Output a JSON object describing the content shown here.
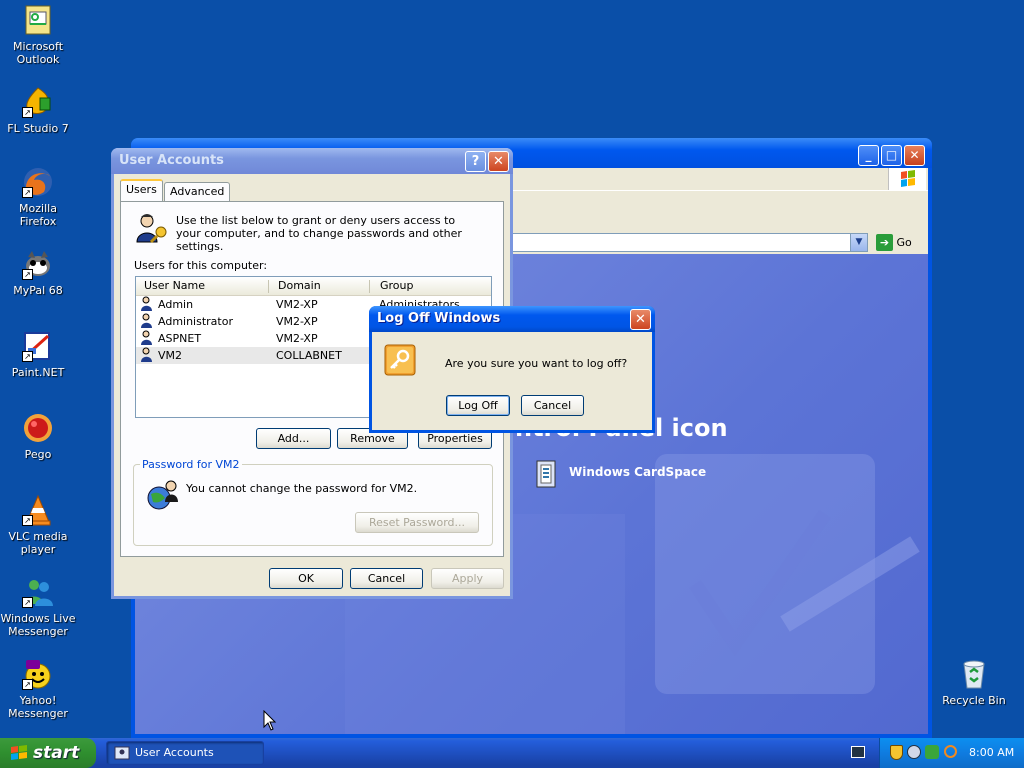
{
  "desktop": {
    "icons": [
      {
        "label": "Microsoft Outlook",
        "icon": "outlook-icon"
      },
      {
        "label": "FL Studio 7",
        "icon": "fl-studio-icon"
      },
      {
        "label": "Mozilla Firefox",
        "icon": "firefox-icon"
      },
      {
        "label": "MyPal 68",
        "icon": "mypal-icon"
      },
      {
        "label": "Paint.NET",
        "icon": "paint-net-icon"
      },
      {
        "label": "Pego",
        "icon": "pego-icon"
      },
      {
        "label": "VLC media player",
        "icon": "vlc-icon"
      },
      {
        "label": "Windows Live Messenger",
        "icon": "messenger-icon"
      },
      {
        "label": "Yahoo! Messenger",
        "icon": "yahoo-messenger-icon"
      },
      {
        "label": "Recycle Bin",
        "icon": "recycle-bin-icon"
      }
    ]
  },
  "explorer": {
    "go_label": "Go",
    "heading_partial": "ntrol Panel icon",
    "cardspace_label": "Windows CardSpace"
  },
  "user_accounts": {
    "title": "User Accounts",
    "help_glyph": "?",
    "close_glyph": "✕",
    "tabs": [
      {
        "label": "Users"
      },
      {
        "label": "Advanced"
      }
    ],
    "intro": "Use the list below to grant or deny users access to your computer, and to change passwords and other settings.",
    "users_label": "Users for this computer:",
    "columns": [
      "User Name",
      "Domain",
      "Group"
    ],
    "rows": [
      {
        "name": "Admin",
        "domain": "VM2-XP",
        "group": "Administrators"
      },
      {
        "name": "Administrator",
        "domain": "VM2-XP",
        "group": ""
      },
      {
        "name": "ASPNET",
        "domain": "VM2-XP",
        "group": ""
      },
      {
        "name": "VM2",
        "domain": "COLLABNET",
        "group": ""
      }
    ],
    "add_label": "Add...",
    "remove_label": "Remove",
    "properties_label": "Properties",
    "password_group_label": "Password for VM2",
    "password_text": "You cannot change the password for VM2.",
    "reset_label": "Reset Password...",
    "ok_label": "OK",
    "cancel_label": "Cancel",
    "apply_label": "Apply"
  },
  "logoff": {
    "title": "Log Off Windows",
    "close_glyph": "✕",
    "message": "Are you sure you want to log off?",
    "logoff_label": "Log Off",
    "cancel_label": "Cancel"
  },
  "taskbar": {
    "start_label": "start",
    "task_item": "User Accounts",
    "clock": "8:00 AM"
  }
}
